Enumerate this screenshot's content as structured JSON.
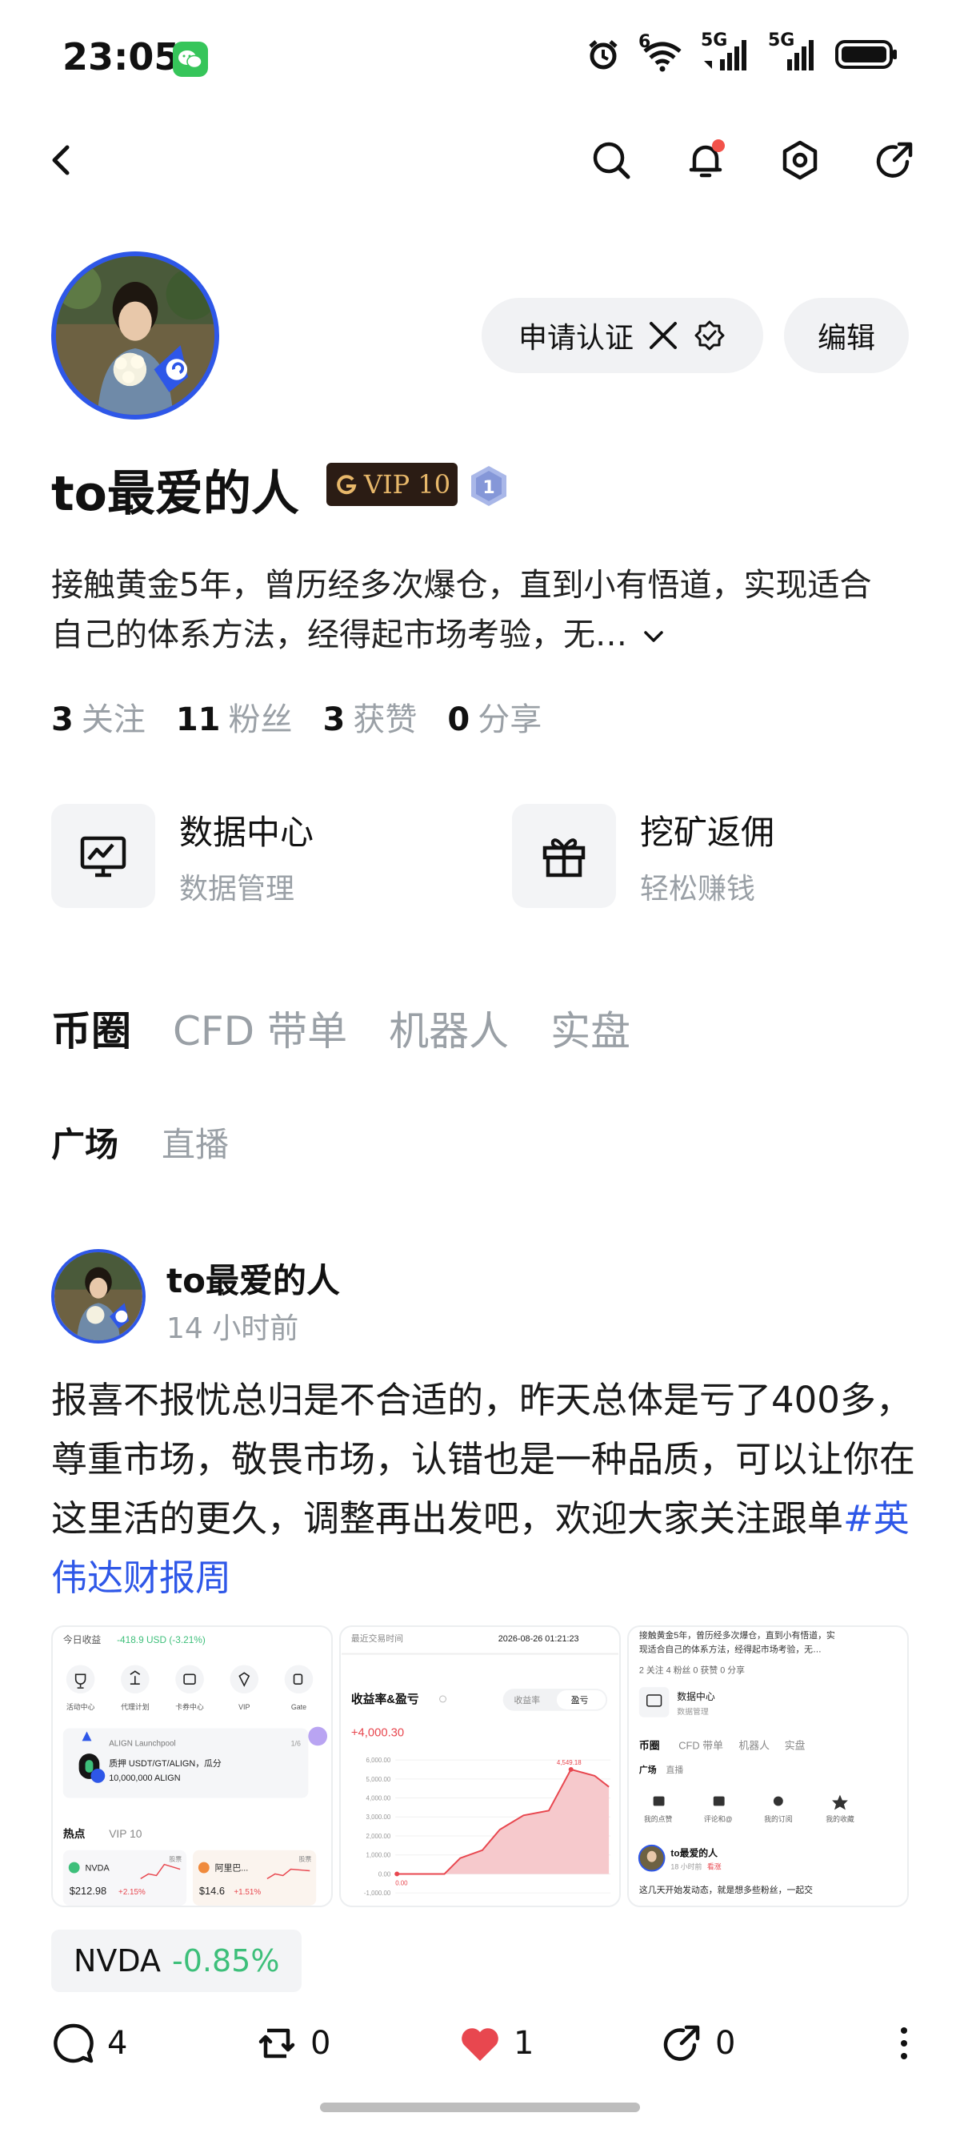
{
  "status_bar": {
    "time": "23:05",
    "signal1_label": "5G",
    "signal2_label": "5G",
    "wifi_label": "6",
    "icons": [
      "wechat-icon",
      "alarm-icon",
      "wifi-icon",
      "signal-icon",
      "battery-icon"
    ]
  },
  "topnav": {
    "icons": [
      "back-icon",
      "search-icon",
      "bell-icon",
      "settings-icon",
      "share-icon"
    ],
    "notification_dot_color": "#f2524a"
  },
  "profile": {
    "verify_label": "申请认证",
    "edit_label": "编辑",
    "name": "to最爱的人",
    "vip_label": "VIP 10",
    "level": "1",
    "bio": "接触黄金5年，曾历经多次爆仓，直到小有悟道，实现适合自己的体系方法，经得起市场考验，无…",
    "stats": [
      {
        "num": "3",
        "label": "关注"
      },
      {
        "num": "11",
        "label": "粉丝"
      },
      {
        "num": "3",
        "label": "获赞"
      },
      {
        "num": "0",
        "label": "分享"
      }
    ]
  },
  "quick_cards": [
    {
      "title": "数据中心",
      "sub": "数据管理",
      "icon": "chart-monitor-icon"
    },
    {
      "title": "挖矿返佣",
      "sub": "轻松赚钱",
      "icon": "gift-icon"
    }
  ],
  "tabs": [
    "币圈",
    "CFD 带单",
    "机器人",
    "实盘"
  ],
  "subtabs": [
    "广场",
    "直播"
  ],
  "post": {
    "author": "to最爱的人",
    "time": "14 小时前",
    "body": "报喜不报忧总归是不合适的，昨天总体是亏了400多，尊重市场，敬畏市场，认错也是一种品质，可以让你在这里活的更久，调整再出发吧，欢迎大家关注跟单",
    "hashtag": "#英伟达财报周",
    "thumb1": {
      "header": "今日收益",
      "pnl": "-418.9 USD (-3.21%)",
      "icons": [
        "活动中心",
        "代理计划",
        "卡券中心",
        "VIP",
        "Gate"
      ],
      "launch_title": "ALIGN Launchpool",
      "launch_page": "1/6",
      "launch_desc1": "质押 USDT/GT/ALIGN，瓜分",
      "launch_desc2": "10,000,000 ALIGN",
      "hot_label": "热点",
      "vip_label": "VIP 10",
      "stock1_name": "NVDA",
      "stock1_price": "$212.98",
      "stock1_change": "+2.15%",
      "stock1_tag": "股票",
      "stock2_name": "阿里巴...",
      "stock2_price": "$14.6",
      "stock2_change": "+1.51%",
      "stock2_tag": "股票"
    },
    "thumb2": {
      "label": "最近交易时间",
      "datetime": "2026-08-26 01:21:23",
      "title": "收益率&盈亏",
      "seg1": "收益率",
      "seg2": "盈亏",
      "value": "+4,000.30",
      "peak_label": "4,549.18",
      "start_label": "0.00",
      "y_ticks": [
        "6,000.00",
        "5,000.00",
        "4,000.00",
        "3,000.00",
        "2,000.00",
        "1,000.00",
        "0.00",
        "-1,000.00"
      ]
    },
    "thumb3": {
      "bio_line1": "接触黄金5年，曾历经多次爆仓，直到小有悟道，实",
      "bio_line2": "现适合自己的体系方法，经得起市场考验，无…",
      "stats": "2 关注   4 粉丝   0 获赞   0 分享",
      "card_title": "数据中心",
      "card_sub": "数据管理",
      "tabs": [
        "币圈",
        "CFD 带单",
        "机器人",
        "实盘"
      ],
      "subtabs": [
        "广场",
        "直播"
      ],
      "icons": [
        "我的点赞",
        "评论和@",
        "我的订阅",
        "我的收藏"
      ],
      "author": "to最爱的人",
      "time": "18 小时前",
      "tag": "看涨",
      "excerpt": "这几天开始发动态，就是想多些粉丝，一起交"
    },
    "ticker_name": "NVDA",
    "ticker_change": "-0.85%"
  },
  "actions": {
    "comments": "4",
    "reposts": "0",
    "likes": "1",
    "shares": "0"
  },
  "colors": {
    "accent_blue": "#2e57e8",
    "like_red": "#e8474f",
    "gain_green": "#3dbf7a",
    "loss_red": "#e8474f",
    "vip_bg": "#2b1c14",
    "vip_gold": "#e8b86a"
  }
}
